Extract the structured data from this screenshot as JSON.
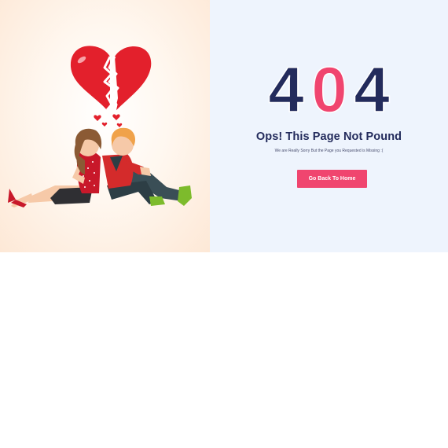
{
  "error": {
    "code_digits": [
      "4",
      "0",
      "4"
    ],
    "title": "Ops! This Page Not Pound",
    "subtitle": "We are Really Sorry But the Page you Requested is Missing :(",
    "button_label": "Go Back To Home"
  },
  "colors": {
    "navy": "#232b5c",
    "pink": "#f0456f",
    "heart_red": "#e3202c",
    "right_bg": "#eef4fd"
  },
  "illustration": {
    "icon": "broken-heart-couple-illustration"
  }
}
